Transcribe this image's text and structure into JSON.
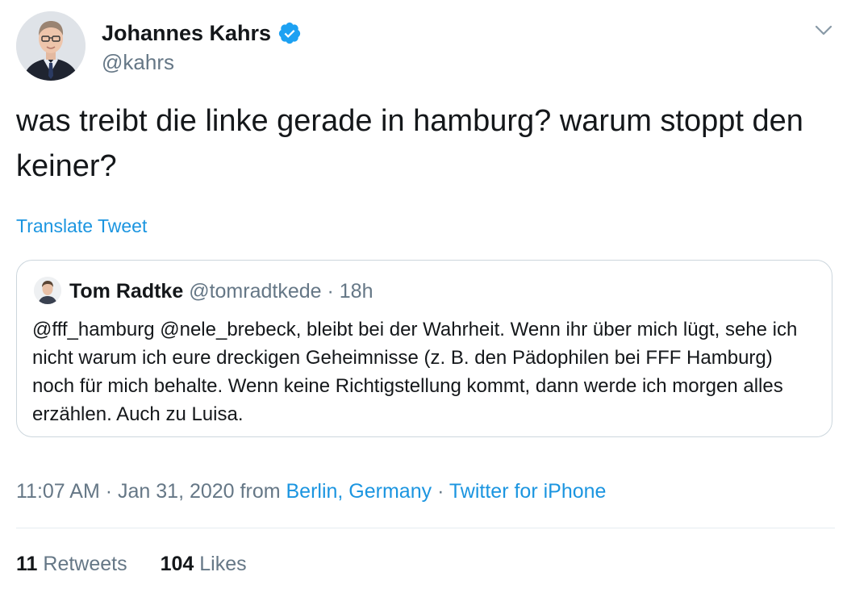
{
  "author": {
    "name": "Johannes Kahrs",
    "handle": "@kahrs",
    "verified": true
  },
  "tweet": {
    "text": "was treibt die linke gerade in hamburg? warum stoppt den keiner?",
    "translate_label": "Translate Tweet"
  },
  "quoted_tweet": {
    "name": "Tom Radtke",
    "handle": "@tomradtkede",
    "separator": "·",
    "time": "18h",
    "text": "@fff_hamburg @nele_brebeck, bleibt bei der Wahrheit. Wenn ihr über mich lügt, sehe ich nicht warum ich eure dreckigen Geheimnisse (z. B. den Pädophilen bei FFF Hamburg) noch für mich behalte. Wenn keine Richtigstellung kommt, dann werde ich morgen alles erzählen. Auch zu Luisa."
  },
  "meta": {
    "time": "11:07 AM",
    "separator": "·",
    "date": "Jan 31, 2020",
    "from_label": "from",
    "location": "Berlin, Germany",
    "separator2": "·",
    "source": "Twitter for iPhone"
  },
  "stats": {
    "retweets_count": "11",
    "retweets_label": "Retweets",
    "likes_count": "104",
    "likes_label": "Likes"
  },
  "icons": {
    "verified": "verified-badge-icon",
    "caret": "chevron-down-icon"
  },
  "colors": {
    "link": "#1b95e0",
    "secondary_text": "#657786",
    "primary_text": "#14171a",
    "border": "#ccd6dd"
  }
}
